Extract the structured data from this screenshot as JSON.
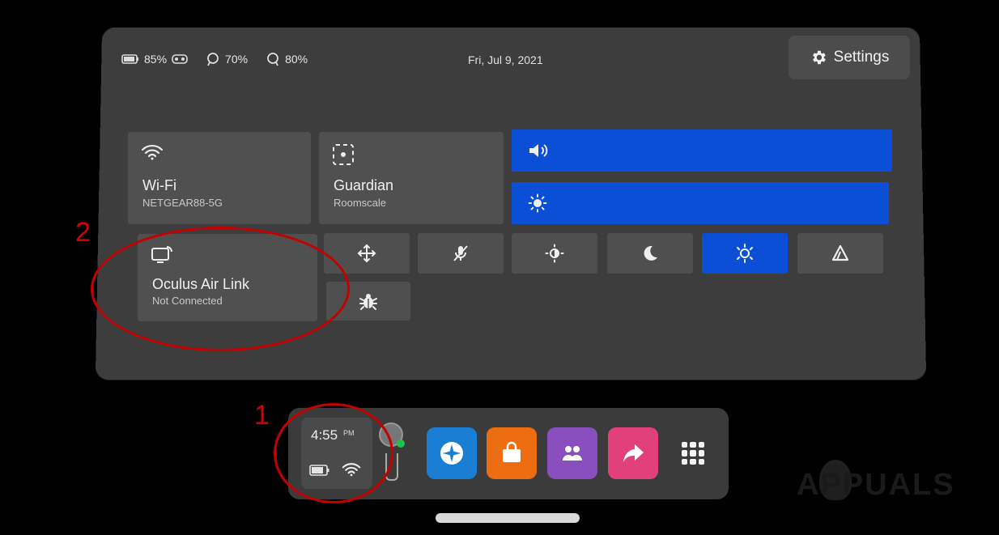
{
  "status_bar": {
    "battery_headset": "85%",
    "controller_left": "70%",
    "controller_right": "80%",
    "date": "Fri, Jul 9, 2021"
  },
  "settings_button": {
    "label": "Settings"
  },
  "tiles": {
    "wifi": {
      "name": "Wi-Fi",
      "sub": "NETGEAR88-5G"
    },
    "guardian": {
      "name": "Guardian",
      "sub": "Roomscale"
    },
    "air_link": {
      "name": "Oculus Air Link",
      "sub": "Not Connected"
    }
  },
  "sliders": {
    "volume": {
      "icon": "volume-icon",
      "color": "#0a4fd6"
    },
    "brightness": {
      "icon": "brightness-icon",
      "color": "#0a4fd6"
    }
  },
  "quick_toggles": [
    {
      "name": "move-toggle",
      "icon": "move-arrows-icon",
      "active": false
    },
    {
      "name": "mic-mute-toggle",
      "icon": "mic-off-icon",
      "active": false
    },
    {
      "name": "brightness-auto-toggle",
      "icon": "sun-half-icon",
      "active": false
    },
    {
      "name": "night-display-toggle",
      "icon": "moon-icon",
      "active": false
    },
    {
      "name": "passthrough-toggle",
      "icon": "eye-sun-icon",
      "active": true
    },
    {
      "name": "oculus-link-toggle",
      "icon": "triangle-icon",
      "active": false
    },
    {
      "name": "bug-report-toggle",
      "icon": "bug-icon",
      "active": false
    }
  ],
  "dock": {
    "time": "4:55",
    "ampm": "PM",
    "apps": [
      {
        "name": "explore-app",
        "color": "#1a7fd4"
      },
      {
        "name": "store-app",
        "color": "#ec6d12"
      },
      {
        "name": "people-app",
        "color": "#8a4fbf"
      },
      {
        "name": "share-app",
        "color": "#e2407a"
      }
    ]
  },
  "annotations": {
    "one": "1",
    "two": "2"
  },
  "accent_color": "#0a4fd6",
  "watermark": "APPUALS"
}
